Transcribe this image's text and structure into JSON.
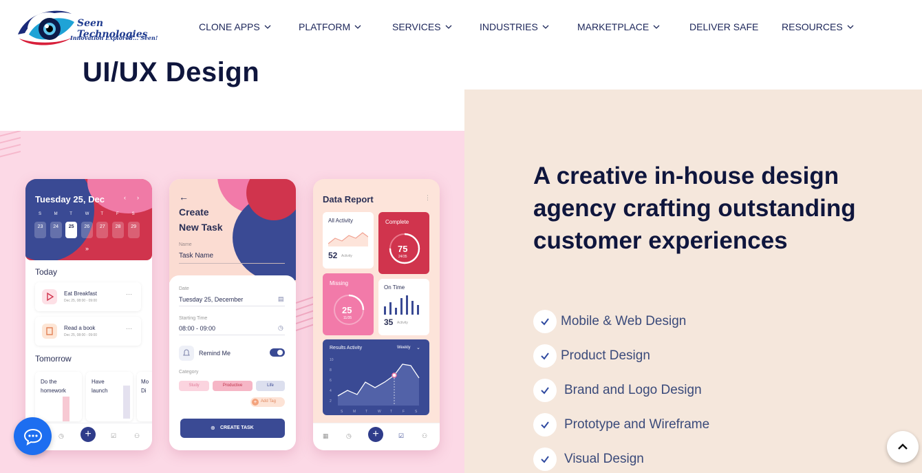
{
  "brand": {
    "name": "Seen Technologies",
    "tagline": "Innovation Explored... Seen!"
  },
  "nav": {
    "items": [
      {
        "label": "CLONE APPS",
        "has_dropdown": true
      },
      {
        "label": "PLATFORM",
        "has_dropdown": true
      },
      {
        "label": "SERVICES",
        "has_dropdown": true
      },
      {
        "label": "INDUSTRIES",
        "has_dropdown": true
      },
      {
        "label": "MARKETPLACE",
        "has_dropdown": true
      },
      {
        "label": "DELIVER SAFE",
        "has_dropdown": false
      },
      {
        "label": "RESOURCES",
        "has_dropdown": true
      }
    ]
  },
  "page": {
    "title": "UI/UX Design"
  },
  "hero": {
    "headline": "A creative in-house design agency crafting outstanding customer experiences",
    "features": [
      "Mobile & Web Design",
      "Product Design",
      "Brand and Logo Design",
      "Prototype and Wireframe",
      "Visual Design"
    ]
  },
  "phone1": {
    "date_title": "Tuesday 25, Dec",
    "weekdays": [
      "S",
      "M",
      "T",
      "W",
      "T",
      "F",
      "S"
    ],
    "days": [
      "23",
      "24",
      "25",
      "26",
      "27",
      "28",
      "29"
    ],
    "today_label": "Today",
    "tasks": [
      {
        "title": "Eat Breakfast",
        "time": "Dec 25, 08:00 - 09:00"
      },
      {
        "title": "Read a book",
        "time": "Dec 25, 08:00 - 09:00"
      }
    ],
    "tomorrow_label": "Tomorrow",
    "tomorrow_cards": [
      "Do the homework",
      "Have launch",
      "Mo Di"
    ]
  },
  "phone2": {
    "title_line1": "Create",
    "title_line2": "New Task",
    "name_label": "Name",
    "name_value": "Task Name",
    "date_label": "Date",
    "date_value": "Tuesday 25, December",
    "time_label": "Starting Time",
    "time_value": "08:00 - 09:00",
    "remind_label": "Remind Me",
    "remind_on": true,
    "category_label": "Category",
    "categories": [
      "Study",
      "Productive",
      "Life"
    ],
    "add_tag": "Add Tag",
    "create_button": "CREATE TASK"
  },
  "phone3": {
    "title": "Data Report",
    "all_activity_label": "All Activity",
    "all_activity_value": "52",
    "all_activity_unit": "Activity",
    "complete_label": "Complete",
    "complete_value": "75",
    "complete_sub": "24/35",
    "missing_label": "Missing",
    "missing_value": "25",
    "missing_sub": "11/35",
    "on_time_label": "On Time",
    "on_time_value": "35",
    "on_time_unit": "Activity",
    "results_label": "Results Activity",
    "results_period": "Weekly",
    "results_days": [
      "S",
      "M",
      "T",
      "W",
      "T",
      "F",
      "S"
    ],
    "results_y": [
      "10",
      "8",
      "6",
      "4",
      "2"
    ]
  },
  "colors": {
    "navy": "#0f163d",
    "pink_bg": "#fcd9e6",
    "beige_bg": "#f5e7dc",
    "accent_blue": "#2f3c8a",
    "chat_blue": "#1d6ef0",
    "coral": "#d0344d"
  }
}
